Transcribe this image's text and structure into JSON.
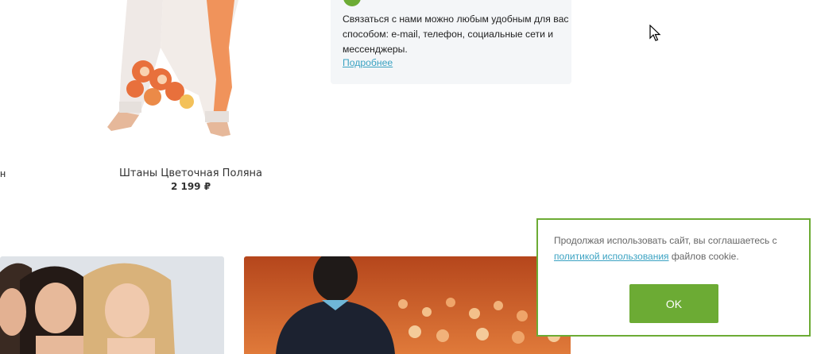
{
  "product": {
    "left_cut_label": "н",
    "title": "Штаны Цветочная Поляна",
    "price": "2 199 ₽"
  },
  "info": {
    "text": "Связаться с нами можно любым удобным для вас способом: e-mail, телефон, социальные сети и мессенджеры.",
    "link": "Подробнее"
  },
  "cookie": {
    "text_before": "Продолжая использовать сайт, вы соглашаетесь с ",
    "link": "политикой использования",
    "text_after": " файлов cookie.",
    "ok_label": "OK"
  },
  "colors": {
    "accent_green": "#6cab34",
    "link_blue": "#3aa2c2",
    "info_bg": "#f4f6f8"
  },
  "icons": [
    "green-circle-icon",
    "mouse-pointer-icon"
  ]
}
